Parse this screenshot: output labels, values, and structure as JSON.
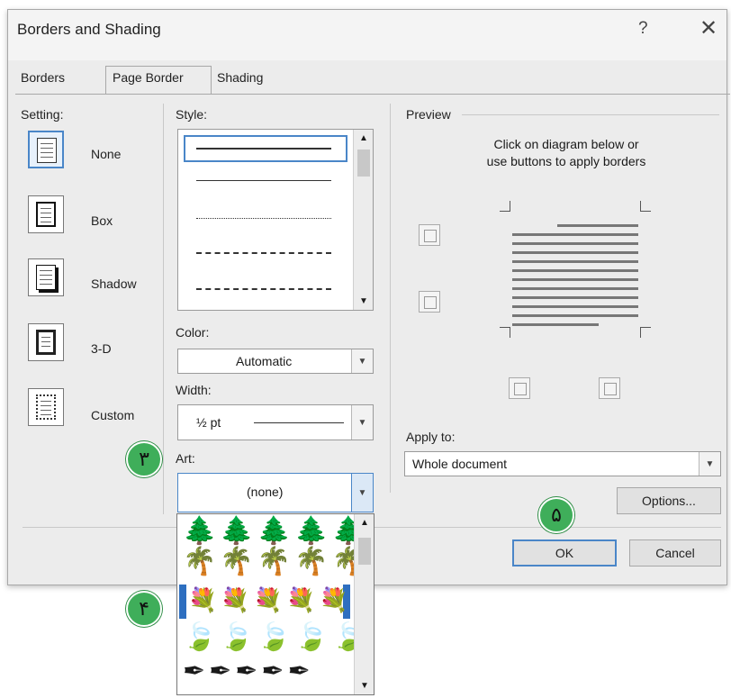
{
  "dialog": {
    "title": "Borders and Shading",
    "help_label": "?",
    "close_label": "✕"
  },
  "tabs": [
    {
      "label": "Borders",
      "active": false
    },
    {
      "label": "Page Border",
      "active": true
    },
    {
      "label": "Shading",
      "active": false
    }
  ],
  "setting": {
    "label": "Setting:",
    "options": [
      {
        "label": "None",
        "selected": true
      },
      {
        "label": "Box",
        "selected": false
      },
      {
        "label": "Shadow",
        "selected": false
      },
      {
        "label": "3-D",
        "selected": false
      },
      {
        "label": "Custom",
        "selected": false
      }
    ]
  },
  "style": {
    "label": "Style:",
    "items": [
      "solid",
      "thin-solid",
      "dotted",
      "dashed",
      "dash-dot"
    ]
  },
  "color": {
    "label": "Color:",
    "value": "Automatic"
  },
  "width": {
    "label": "Width:",
    "value": "½ pt"
  },
  "art": {
    "label": "Art:",
    "value": "(none)",
    "options": [
      "tree-art",
      "flower-bouquet-art",
      "purple-leaf-art",
      "pen-nib-art"
    ],
    "highlighted_index": 1
  },
  "preview": {
    "label": "Preview",
    "instructions_line1": "Click on diagram below or",
    "instructions_line2": "use buttons to apply borders"
  },
  "apply_to": {
    "label": "Apply to:",
    "value": "Whole document"
  },
  "buttons": {
    "options": "Options...",
    "ok": "OK",
    "cancel": "Cancel"
  },
  "annotations": {
    "art_step": "٣",
    "art_option_step": "۴",
    "ok_step": "۵"
  },
  "colors": {
    "accent": "#4a86c8",
    "badge": "#3fae5a"
  }
}
